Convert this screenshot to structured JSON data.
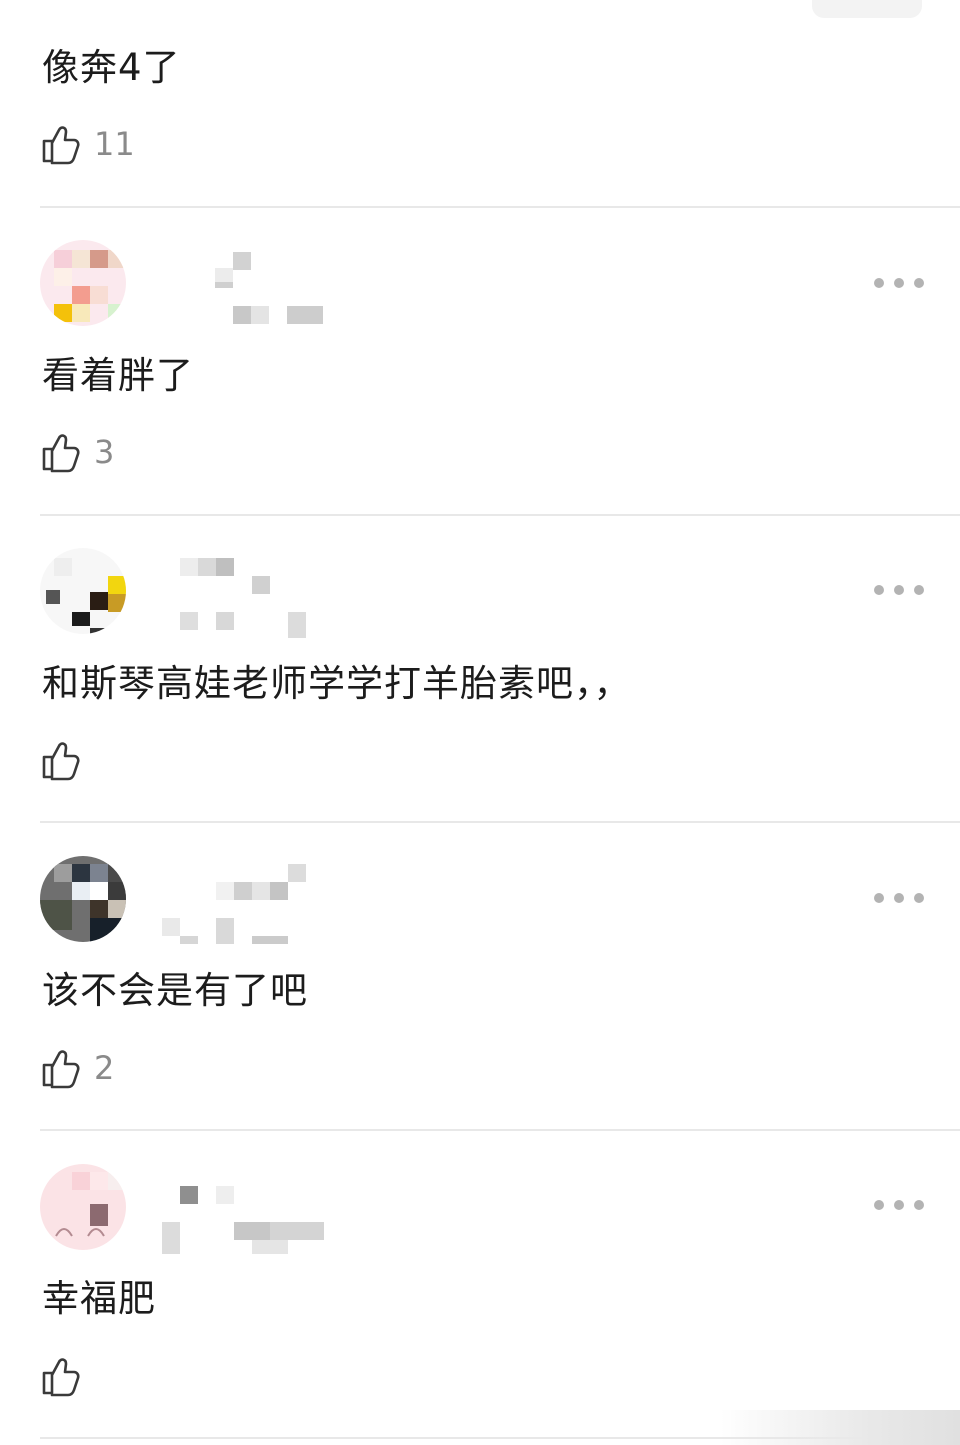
{
  "comments": [
    {
      "text": "像奔4了",
      "likes": "11",
      "has_header": false
    },
    {
      "text": "看着胖了",
      "likes": "3",
      "has_header": true
    },
    {
      "text": "和斯琴高娃老师学学打羊胎素吧，，",
      "likes": "",
      "has_header": true
    },
    {
      "text": "该不会是有了吧",
      "likes": "2",
      "has_header": true
    },
    {
      "text": "幸福肥",
      "likes": "",
      "has_header": true
    }
  ],
  "icons": {
    "like": "thumbs-up-icon",
    "more": "more-dots-icon"
  },
  "colors": {
    "divider": "#e8e8e8",
    "like_count": "#8a8a8a",
    "dots": "#b3b3b3"
  }
}
